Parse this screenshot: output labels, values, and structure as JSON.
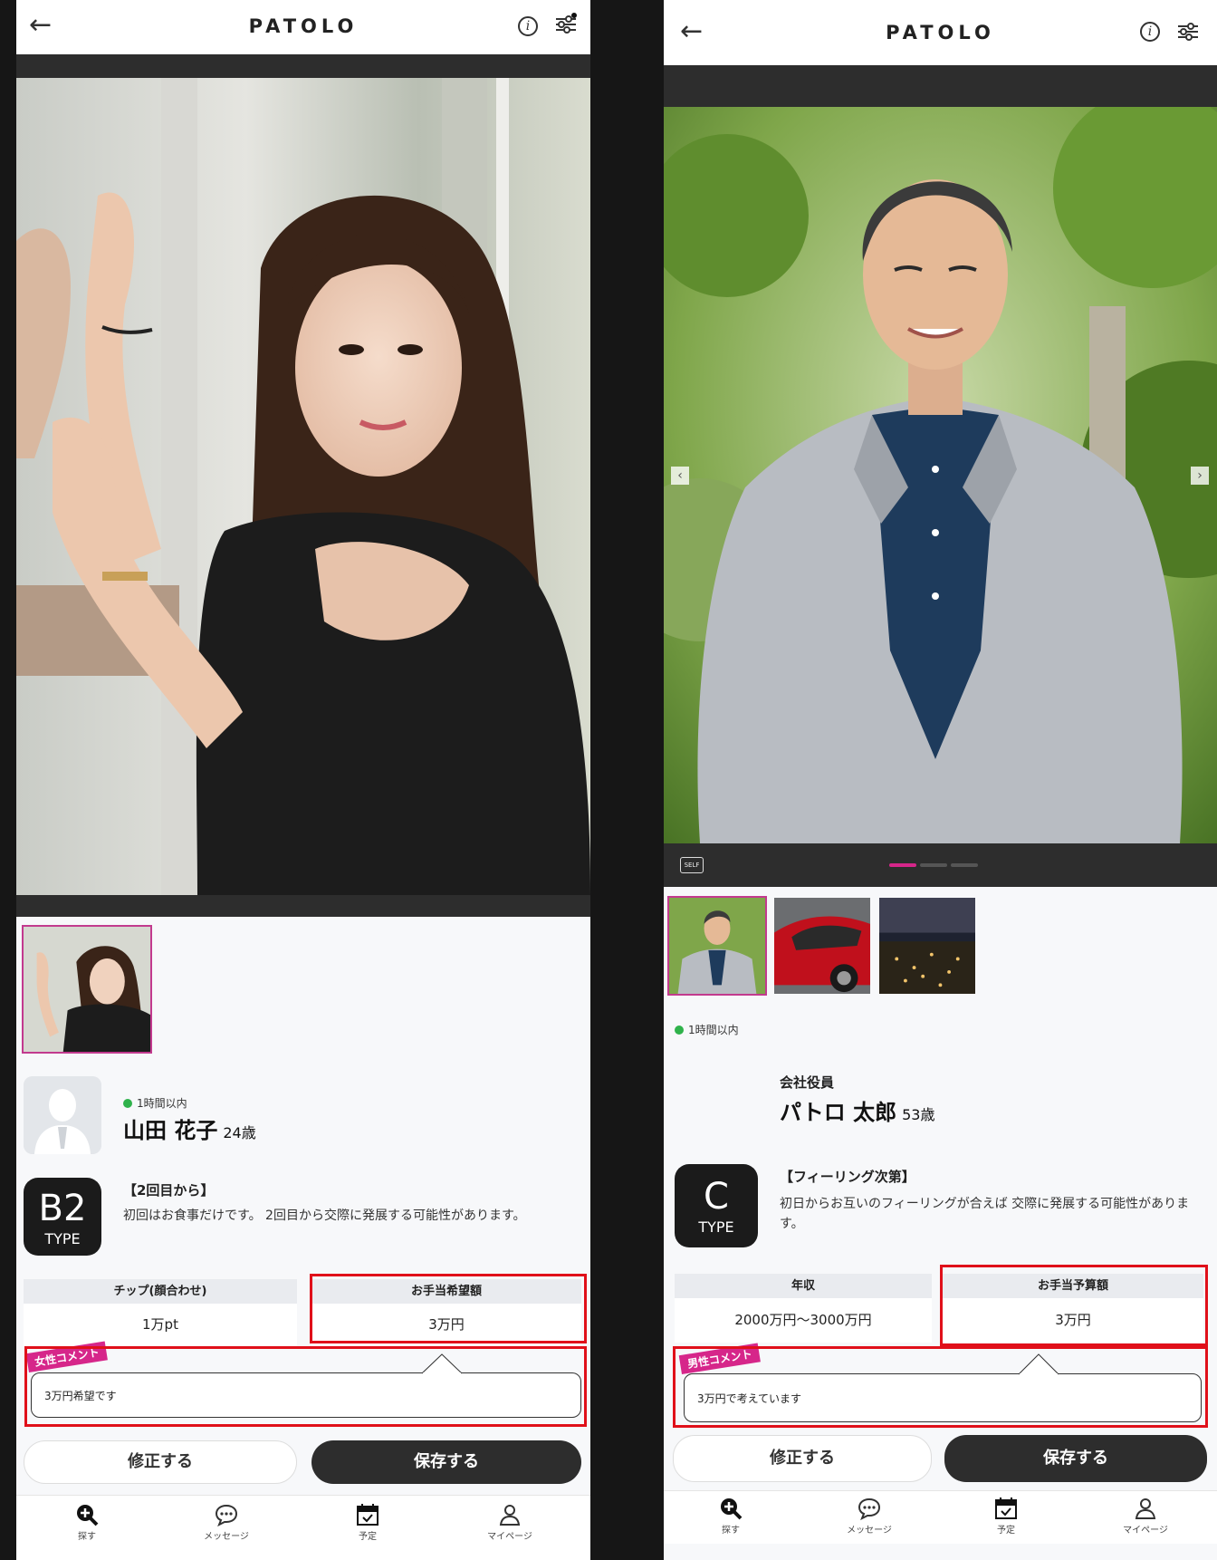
{
  "app": {
    "logo": "PATOLO",
    "back_icon": "arrow-left-icon",
    "info_icon": "info-icon",
    "filter_icon": "sliders-icon"
  },
  "left": {
    "online": "1時間以内",
    "name": "山田 花子",
    "age": "24歳",
    "type": {
      "code": "B2",
      "label": "TYPE",
      "title": "【2回目から】",
      "desc": "初回はお食事だけです。 2回目から交際に発展する可能性があります。"
    },
    "cells": [
      {
        "header": "チップ(顔合わせ)",
        "value": "1万pt"
      },
      {
        "header": "お手当希望額",
        "value": "3万円"
      }
    ],
    "comment_tag": "女性コメント",
    "comment": "3万円希望です",
    "buttons": {
      "edit": "修正する",
      "save": "保存する"
    }
  },
  "right": {
    "self_badge": "SELF",
    "online": "1時間以内",
    "job": "会社役員",
    "name": "パトロ 太郎",
    "age": "53歳",
    "type": {
      "code": "C",
      "label": "TYPE",
      "title": "【フィーリング次第】",
      "desc": "初日からお互いのフィーリングが合えば 交際に発展する可能性があります。"
    },
    "cells": [
      {
        "header": "年収",
        "value": "2000万円〜3000万円"
      },
      {
        "header": "お手当予算額",
        "value": "3万円"
      }
    ],
    "comment_tag": "男性コメント",
    "comment": "3万円で考えています",
    "buttons": {
      "edit": "修正する",
      "save": "保存する"
    }
  },
  "nav": [
    {
      "label": "探す",
      "icon": "search-plus-icon"
    },
    {
      "label": "メッセージ",
      "icon": "chat-bubble-icon"
    },
    {
      "label": "予定",
      "icon": "calendar-check-icon"
    },
    {
      "label": "マイページ",
      "icon": "person-icon"
    }
  ],
  "colors": {
    "accent": "#d6268a",
    "highlight": "#e0101a",
    "dark": "#2d2d2d",
    "online": "#2fb24b"
  }
}
